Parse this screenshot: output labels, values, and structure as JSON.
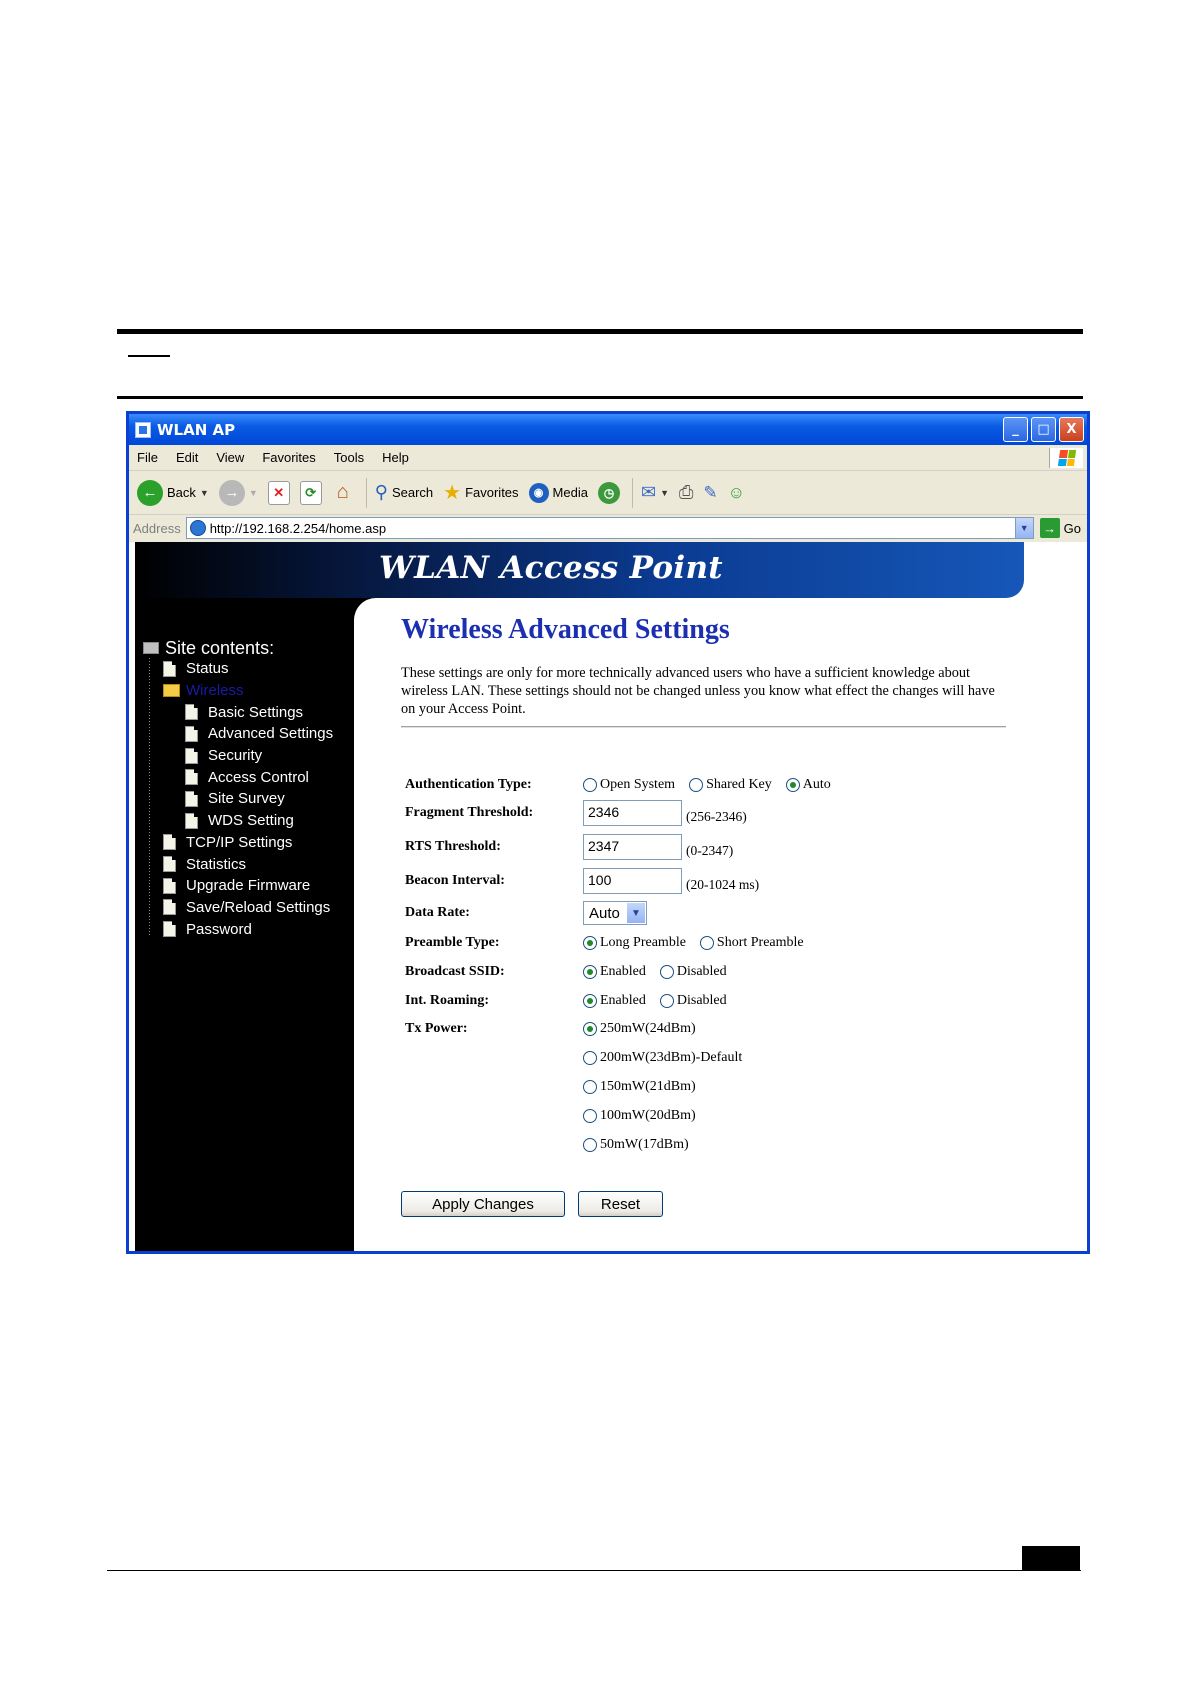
{
  "window": {
    "title": "WLAN AP",
    "buttons": {
      "minimize": "_",
      "maximize": "□",
      "close": "X"
    }
  },
  "menu": [
    "File",
    "Edit",
    "View",
    "Favorites",
    "Tools",
    "Help"
  ],
  "toolbar": {
    "back": "Back",
    "search": "Search",
    "favorites": "Favorites",
    "media": "Media"
  },
  "address": {
    "label": "Address",
    "url": "http://192.168.2.254/home.asp",
    "go": "Go"
  },
  "banner": {
    "title": "WLAN Access Point"
  },
  "tree": {
    "root": "Site contents:",
    "items": [
      {
        "label": "Status"
      },
      {
        "label": "Wireless"
      },
      {
        "label": "Basic Settings"
      },
      {
        "label": "Advanced Settings"
      },
      {
        "label": "Security"
      },
      {
        "label": "Access Control"
      },
      {
        "label": "Site Survey"
      },
      {
        "label": "WDS Setting"
      },
      {
        "label": "TCP/IP Settings"
      },
      {
        "label": "Statistics"
      },
      {
        "label": "Upgrade Firmware"
      },
      {
        "label": "Save/Reload Settings"
      },
      {
        "label": "Password"
      }
    ]
  },
  "page": {
    "title": "Wireless Advanced Settings",
    "intro": "These settings are only for more technically advanced users who have a sufficient knowledge about wireless LAN. These settings should not be changed unless you know what effect the changes will have on your Access Point."
  },
  "form": {
    "auth": {
      "label": "Authentication Type:",
      "options": [
        "Open System",
        "Shared Key",
        "Auto"
      ],
      "selected": "Auto"
    },
    "frag": {
      "label": "Fragment Threshold:",
      "value": "2346",
      "range": "(256-2346)"
    },
    "rts": {
      "label": "RTS Threshold:",
      "value": "2347",
      "range": "(0-2347)"
    },
    "beacon": {
      "label": "Beacon Interval:",
      "value": "100",
      "range": "(20-1024 ms)"
    },
    "rate": {
      "label": "Data Rate:",
      "value": "Auto"
    },
    "preamble": {
      "label": "Preamble Type:",
      "options": [
        "Long Preamble",
        "Short Preamble"
      ],
      "selected": "Long Preamble"
    },
    "ssid": {
      "label": "Broadcast SSID:",
      "options": [
        "Enabled",
        "Disabled"
      ],
      "selected": "Enabled"
    },
    "roaming": {
      "label": "Int. Roaming:",
      "options": [
        "Enabled",
        "Disabled"
      ],
      "selected": "Enabled"
    },
    "txpower": {
      "label": "Tx Power:",
      "options": [
        "250mW(24dBm)",
        "200mW(23dBm)-Default",
        "150mW(21dBm)",
        "100mW(20dBm)",
        "50mW(17dBm)"
      ],
      "selected": "250mW(24dBm)"
    }
  },
  "buttons": {
    "apply": "Apply Changes",
    "reset": "Reset"
  }
}
